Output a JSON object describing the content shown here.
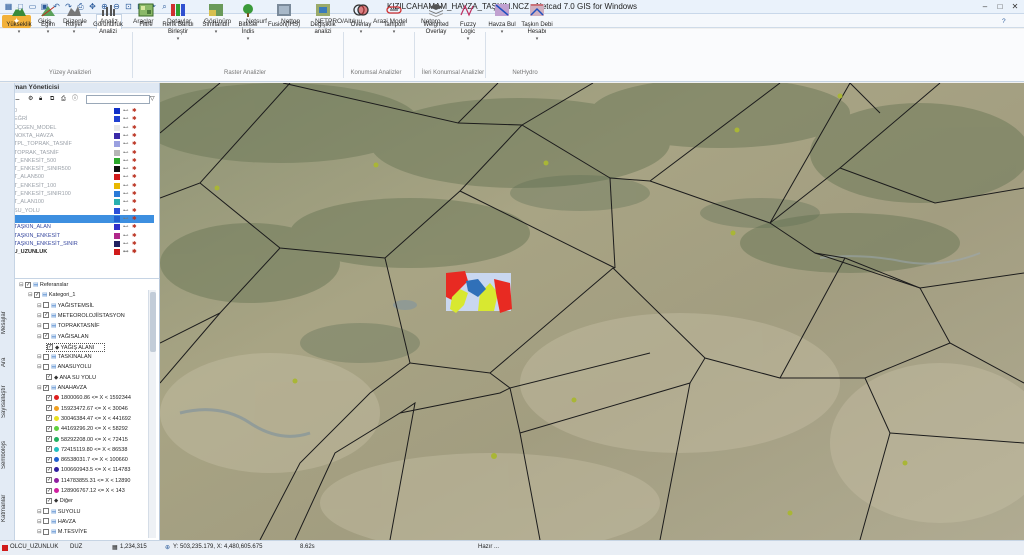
{
  "titlebar": {
    "title": "KIZILCAHAMAM_HAVZA_TAŞKIN.NCZ - Netcad 7.0 GIS for Windows"
  },
  "menu": {
    "tabs": [
      {
        "label": "Giriş"
      },
      {
        "label": "Düzenle"
      },
      {
        "label": "Analiz"
      },
      {
        "label": "Araçlar"
      },
      {
        "label": "Detaylar"
      },
      {
        "label": "Görünüm"
      },
      {
        "label": "Netsurf"
      },
      {
        "label": "Nettop"
      },
      {
        "label": "NETPRO/Altıkıu"
      },
      {
        "label": "Arazi Model"
      },
      {
        "label": "Netpro"
      }
    ],
    "active": "Analiz"
  },
  "ribbon": {
    "buttons": [
      {
        "label": "Yükseklik"
      },
      {
        "label": "Eğim"
      },
      {
        "label": "Rölyef"
      },
      {
        "label": "Görünürlük Analizi"
      },
      {
        "label": "Filtre"
      },
      {
        "label": "Renk Bandı Birleştir"
      },
      {
        "label": "Sınıflandır"
      },
      {
        "label": "Bitkisel İndis"
      },
      {
        "label": "Fusion(IHS)"
      },
      {
        "label": "Değişiklik analizi"
      },
      {
        "label": "Overlay"
      },
      {
        "label": "Tampon"
      },
      {
        "label": "Weighted Overlay"
      },
      {
        "label": "Fuzzy Logic"
      },
      {
        "label": "Havza Bul"
      },
      {
        "label": "Taşkın Debi Hesabı"
      }
    ],
    "groups": [
      {
        "label": "Yüzey Analizleri"
      },
      {
        "label": "Raster Analizler"
      },
      {
        "label": "Konumsal Analizler"
      },
      {
        "label": "İleri Konumsal Analizler"
      },
      {
        "label": "NetHydro"
      }
    ]
  },
  "left_tabs": [
    "Mesajlar",
    "Ara",
    "Sayısallaştır",
    "Sembolojs",
    "Katmanlar"
  ],
  "layer_panel": {
    "title": "Katman Yöneticisi",
    "layers": [
      {
        "name": "0",
        "color": "#1030c8"
      },
      {
        "name": "EĞRİ",
        "color": "#2040d0"
      },
      {
        "name": "ÜÇGEN_MODEL",
        "color": "#e8e8e8"
      },
      {
        "name": "NOKTA_HAVZA",
        "color": "#3a2aa8"
      },
      {
        "name": "TPL_TOPRAK_TASNİF",
        "color": "#9aa0e0"
      },
      {
        "name": "TOPRAK_TASNİF",
        "color": "#b6b6b6"
      },
      {
        "name": "T_ENKESİT_500",
        "color": "#2aa82a"
      },
      {
        "name": "T_ENKESİT_SINIR500",
        "color": "#101010"
      },
      {
        "name": "T_ALAN500",
        "color": "#d01a1a"
      },
      {
        "name": "T_ENKESİT_100",
        "color": "#e8b800"
      },
      {
        "name": "T_ENKESİT_SINIR100",
        "color": "#2a7ad8"
      },
      {
        "name": "T_ALAN100",
        "color": "#2ab0b0"
      },
      {
        "name": "SU_YOLU",
        "color": "#2a50d8"
      },
      {
        "name": "",
        "color": "#2060d0"
      },
      {
        "name": "TAŞKIN_ALAN",
        "color": "#3030c8"
      },
      {
        "name": "TAŞKIN_ENKESİT",
        "color": "#b0288a"
      },
      {
        "name": "TAŞKIN_ENKESİT_SINIR",
        "color": "#202060"
      },
      {
        "name": "OLCU_UZUNLUK",
        "color": "#d01a1a"
      }
    ]
  },
  "tree": {
    "rows": [
      {
        "label": "Referanslar",
        "indent": 0,
        "checked": true
      },
      {
        "label": "Kategori_1",
        "indent": 1,
        "checked": true
      },
      {
        "label": "YAĞISTEMSİL",
        "indent": 2,
        "checked": false
      },
      {
        "label": "METEOROLOJİİSTASYON",
        "indent": 2,
        "checked": true
      },
      {
        "label": "TOPRAKTASNİF",
        "indent": 2,
        "checked": false
      },
      {
        "label": "YAĞISALAN",
        "indent": 2,
        "checked": true
      },
      {
        "label": "YAĞIŞ ALANI",
        "indent": 3,
        "checked": true
      },
      {
        "label": "TASKINALAN",
        "indent": 2,
        "checked": false
      },
      {
        "label": "ANASUYOLU",
        "indent": 2,
        "checked": false
      },
      {
        "label": "ANA SU YOLU",
        "indent": 3,
        "checked": true
      },
      {
        "label": "ANAHAVZA",
        "indent": 2,
        "checked": true
      },
      {
        "label": "1800060.86 <= X < 1592344",
        "indent": 3,
        "checked": true,
        "dot": "#e02020"
      },
      {
        "label": "15923472.67 <= X < 30046",
        "indent": 3,
        "checked": true,
        "dot": "#f0a020"
      },
      {
        "label": "30046384.47 <= X < 441692",
        "indent": 3,
        "checked": true,
        "dot": "#e8e020"
      },
      {
        "label": "44169296.20 <= X < 58292",
        "indent": 3,
        "checked": true,
        "dot": "#60d040"
      },
      {
        "label": "58292208.00 <= X < 72415",
        "indent": 3,
        "checked": true,
        "dot": "#20b060"
      },
      {
        "label": "72415119.80 <= X < 86538",
        "indent": 3,
        "checked": true,
        "dot": "#20c0c0"
      },
      {
        "label": "86538031.7 <= X < 100660",
        "indent": 3,
        "checked": true,
        "dot": "#2060d0"
      },
      {
        "label": "100660943.5 <= X < 114783",
        "indent": 3,
        "checked": true,
        "dot": "#3020a0"
      },
      {
        "label": "114783855.31 <= X < 12890",
        "indent": 3,
        "checked": true,
        "dot": "#9020a0"
      },
      {
        "label": "128906767.12 <= X < 143",
        "indent": 3,
        "checked": true,
        "dot": "#d020a0"
      },
      {
        "label": "Diğer",
        "indent": 3,
        "checked": true
      },
      {
        "label": "SUYOLU",
        "indent": 2,
        "checked": false
      },
      {
        "label": "HAVZA",
        "indent": 2,
        "checked": false
      },
      {
        "label": "M.TESVİYE",
        "indent": 2,
        "checked": false
      }
    ]
  },
  "status": {
    "layer": "OLCU_UZUNLUK",
    "mode": "DUZ",
    "scale": "1,234,315",
    "coords": "Y: 503,235.179, X: 4,480,605.675",
    "time": "8.62s",
    "ready": "Hazır ..."
  }
}
